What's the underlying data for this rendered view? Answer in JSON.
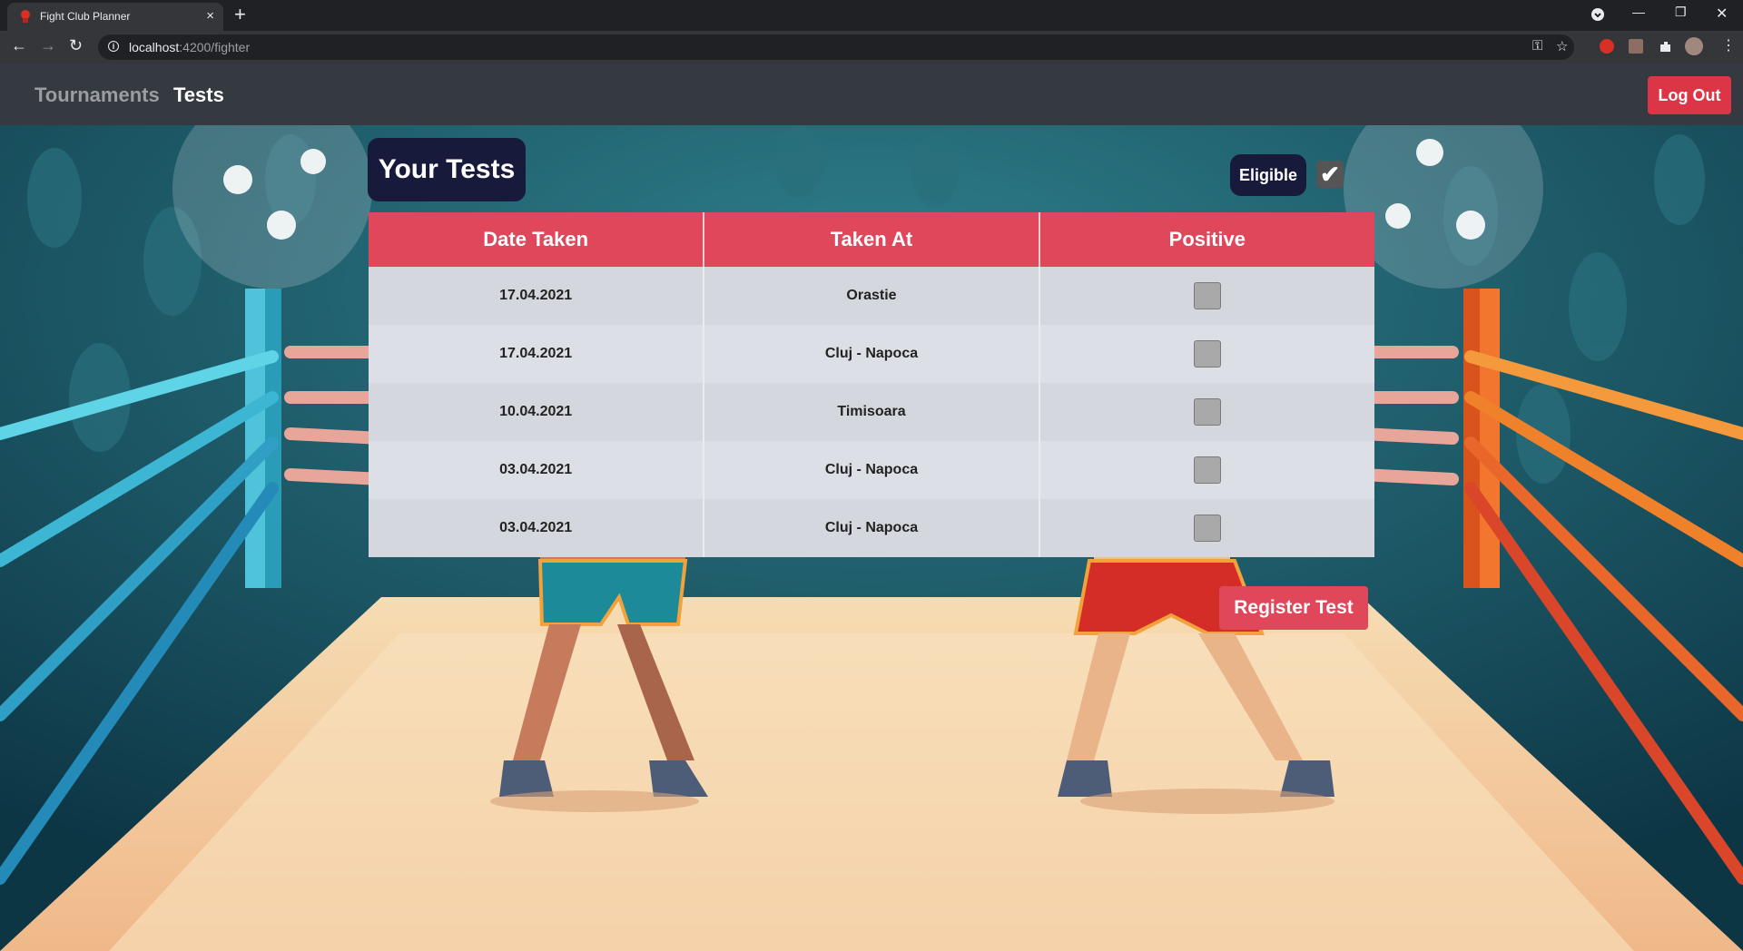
{
  "browser": {
    "tab_title": "Fight Club Planner",
    "tab_close": "×",
    "new_tab": "+",
    "url_host": "localhost",
    "url_path": ":4200/fighter",
    "icons": [
      "back-icon",
      "forward-icon",
      "reload-icon",
      "info-icon",
      "key-icon",
      "star-icon",
      "extensions-icon",
      "profile-icon",
      "menu-icon",
      "minimize-icon",
      "restore-icon",
      "close-icon"
    ]
  },
  "nav": {
    "links": [
      {
        "label": "Tournaments",
        "active": false
      },
      {
        "label": "Tests",
        "active": true
      }
    ],
    "logout_label": "Log Out"
  },
  "page": {
    "title": "Your Tests",
    "eligible_label": "Eligible",
    "eligible_checked": true
  },
  "table": {
    "headers": [
      "Date Taken",
      "Taken At",
      "Positive"
    ],
    "rows": [
      {
        "date": "17.04.2021",
        "place": "Orastie",
        "positive": false
      },
      {
        "date": "17.04.2021",
        "place": "Cluj - Napoca",
        "positive": false
      },
      {
        "date": "10.04.2021",
        "place": "Timisoara",
        "positive": false
      },
      {
        "date": "03.04.2021",
        "place": "Cluj - Napoca",
        "positive": false
      },
      {
        "date": "03.04.2021",
        "place": "Cluj - Napoca",
        "positive": false
      }
    ]
  },
  "actions": {
    "register_label": "Register Test"
  },
  "colors": {
    "accent": "#e0475a",
    "navbar": "#343a40",
    "badge": "#171a3a"
  }
}
